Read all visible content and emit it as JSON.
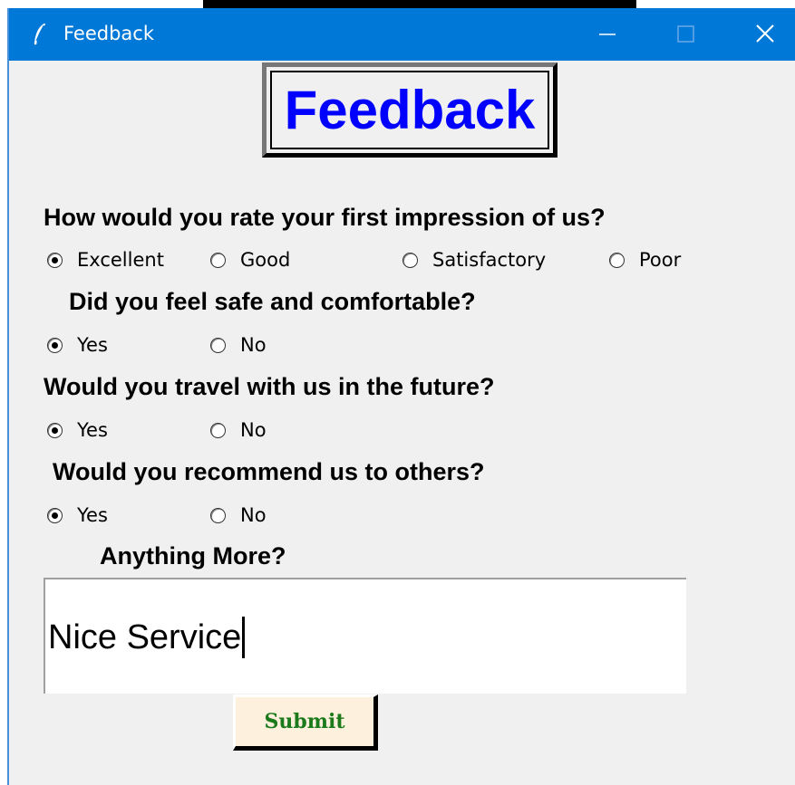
{
  "window": {
    "title": "Feedback",
    "icon": "feather-icon",
    "controls": [
      "minimize-icon",
      "maximize-icon",
      "close-icon"
    ]
  },
  "header": {
    "title": "Feedback",
    "color": "#0000ff"
  },
  "questions": [
    {
      "text": "How would you rate your first impression of us?",
      "options": [
        "Excellent",
        "Good",
        "Satisfactory",
        "Poor"
      ],
      "selected": "Excellent"
    },
    {
      "text": "Did you feel safe and comfortable?",
      "options": [
        "Yes",
        "No"
      ],
      "selected": "Yes"
    },
    {
      "text": "Would you travel with us in the future?",
      "options": [
        "Yes",
        "No"
      ],
      "selected": "Yes"
    },
    {
      "text": "Would you recommend us to others?",
      "options": [
        "Yes",
        "No"
      ],
      "selected": "Yes"
    }
  ],
  "comments": {
    "label": "Anything More?",
    "value": "Nice Service"
  },
  "submit": {
    "label": "Submit",
    "text_color": "#1b7a1b",
    "bg_color": "#fdf0dc"
  },
  "colors": {
    "titlebar": "#0078d7",
    "window_bg": "#f0f0f0"
  }
}
